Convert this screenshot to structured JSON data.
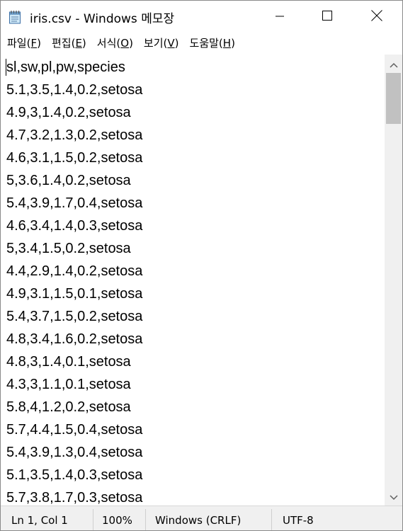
{
  "window": {
    "title": "iris.csv - Windows 메모장"
  },
  "menu": [
    {
      "label": "파일",
      "accel": "(F)",
      "key": "F"
    },
    {
      "label": "편집",
      "accel": "(E)",
      "key": "E"
    },
    {
      "label": "서식",
      "accel": "(O)",
      "key": "O"
    },
    {
      "label": "보기",
      "accel": "(V)",
      "key": "V"
    },
    {
      "label": "도움말",
      "accel": "(H)",
      "key": "H"
    }
  ],
  "editor": {
    "lines": [
      "sl,sw,pl,pw,species",
      "5.1,3.5,1.4,0.2,setosa",
      "4.9,3,1.4,0.2,setosa",
      "4.7,3.2,1.3,0.2,setosa",
      "4.6,3.1,1.5,0.2,setosa",
      "5,3.6,1.4,0.2,setosa",
      "5.4,3.9,1.7,0.4,setosa",
      "4.6,3.4,1.4,0.3,setosa",
      "5,3.4,1.5,0.2,setosa",
      "4.4,2.9,1.4,0.2,setosa",
      "4.9,3.1,1.5,0.1,setosa",
      "5.4,3.7,1.5,0.2,setosa",
      "4.8,3.4,1.6,0.2,setosa",
      "4.8,3,1.4,0.1,setosa",
      "4.3,3,1.1,0.1,setosa",
      "5.8,4,1.2,0.2,setosa",
      "5.7,4.4,1.5,0.4,setosa",
      "5.4,3.9,1.3,0.4,setosa",
      "5.1,3.5,1.4,0.3,setosa",
      "5.7,3.8,1.7,0.3,setosa"
    ]
  },
  "status": {
    "position": "Ln 1, Col 1",
    "zoom": "100%",
    "line_ending": "Windows (CRLF)",
    "encoding": "UTF-8"
  },
  "icons": {
    "app": "notepad-icon",
    "minimize": "minimize-icon",
    "maximize": "maximize-icon",
    "close": "close-icon",
    "scroll_up": "chevron-up-icon",
    "scroll_down": "chevron-down-icon"
  },
  "colors": {
    "background": "#ffffff",
    "statusbar": "#f0f0f0",
    "scroll_thumb": "#c1c1c1"
  }
}
